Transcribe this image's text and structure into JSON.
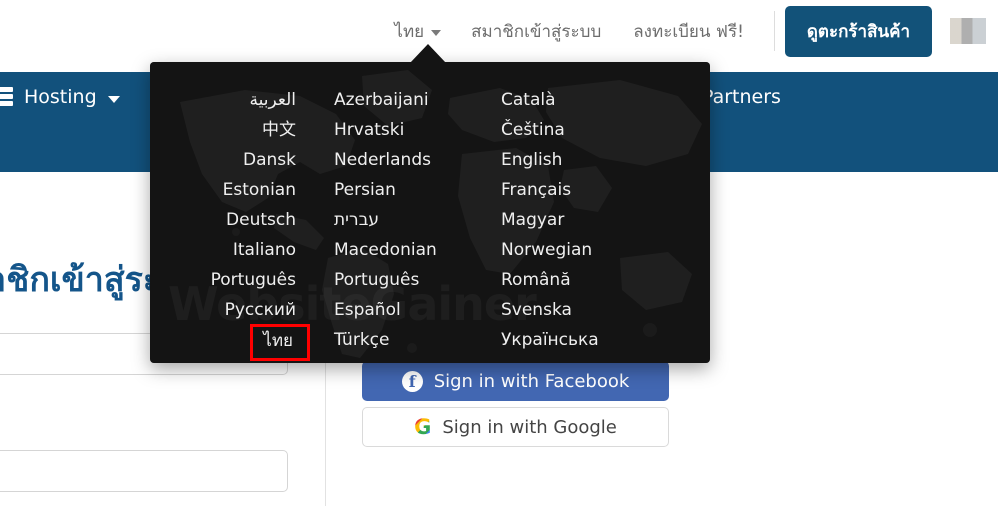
{
  "topbar": {
    "language_toggle": {
      "label": "ไทย",
      "caret": "chevron-down-icon"
    },
    "login_link": "สมาชิกเข้าสู่ระบบ",
    "register_link": "ลงทะเบียน ฟรี!",
    "cart_button": "ดูตะกร้าสินค้า",
    "cart_button_color": "#125279"
  },
  "navbar": {
    "background_color": "#12517C",
    "items": [
      {
        "label": "Hosting",
        "icon": "server-stack-icon",
        "has_caret": true
      },
      {
        "label": "Partners",
        "icon": "",
        "has_caret": false
      }
    ]
  },
  "main": {
    "heading": "สมาชิกเข้าสู่ระบบ",
    "heading_color": "#14558a",
    "fields": [
      {
        "name": "username",
        "value": "",
        "placeholder": ""
      },
      {
        "name": "password",
        "value": "",
        "placeholder": ""
      }
    ],
    "social": {
      "facebook": {
        "label": "Sign in with Facebook",
        "icon": "facebook-icon",
        "color": "#4267B2"
      },
      "google": {
        "label": "Sign in with Google",
        "icon": "google-icon",
        "color": "#ffffff"
      }
    }
  },
  "language_dropdown": {
    "open": true,
    "background_color": "#141414",
    "watermark": "WebsiteGainer",
    "selected": "ไทย",
    "highlight_color": "#ff0000",
    "columns": [
      {
        "items": [
          "العربية",
          "中文",
          "Dansk",
          "Estonian",
          "Deutsch",
          "Italiano",
          "Português",
          "Русский",
          "ไทย"
        ]
      },
      {
        "items": [
          "Azerbaijani",
          "Hrvatski",
          "Nederlands",
          "Persian",
          "עברית",
          "Macedonian",
          "Português",
          "Español",
          "Türkçe"
        ]
      },
      {
        "items": [
          "Català",
          "Čeština",
          "English",
          "Français",
          "Magyar",
          "Norwegian",
          "Română",
          "Svenska",
          "Українська"
        ]
      }
    ]
  }
}
